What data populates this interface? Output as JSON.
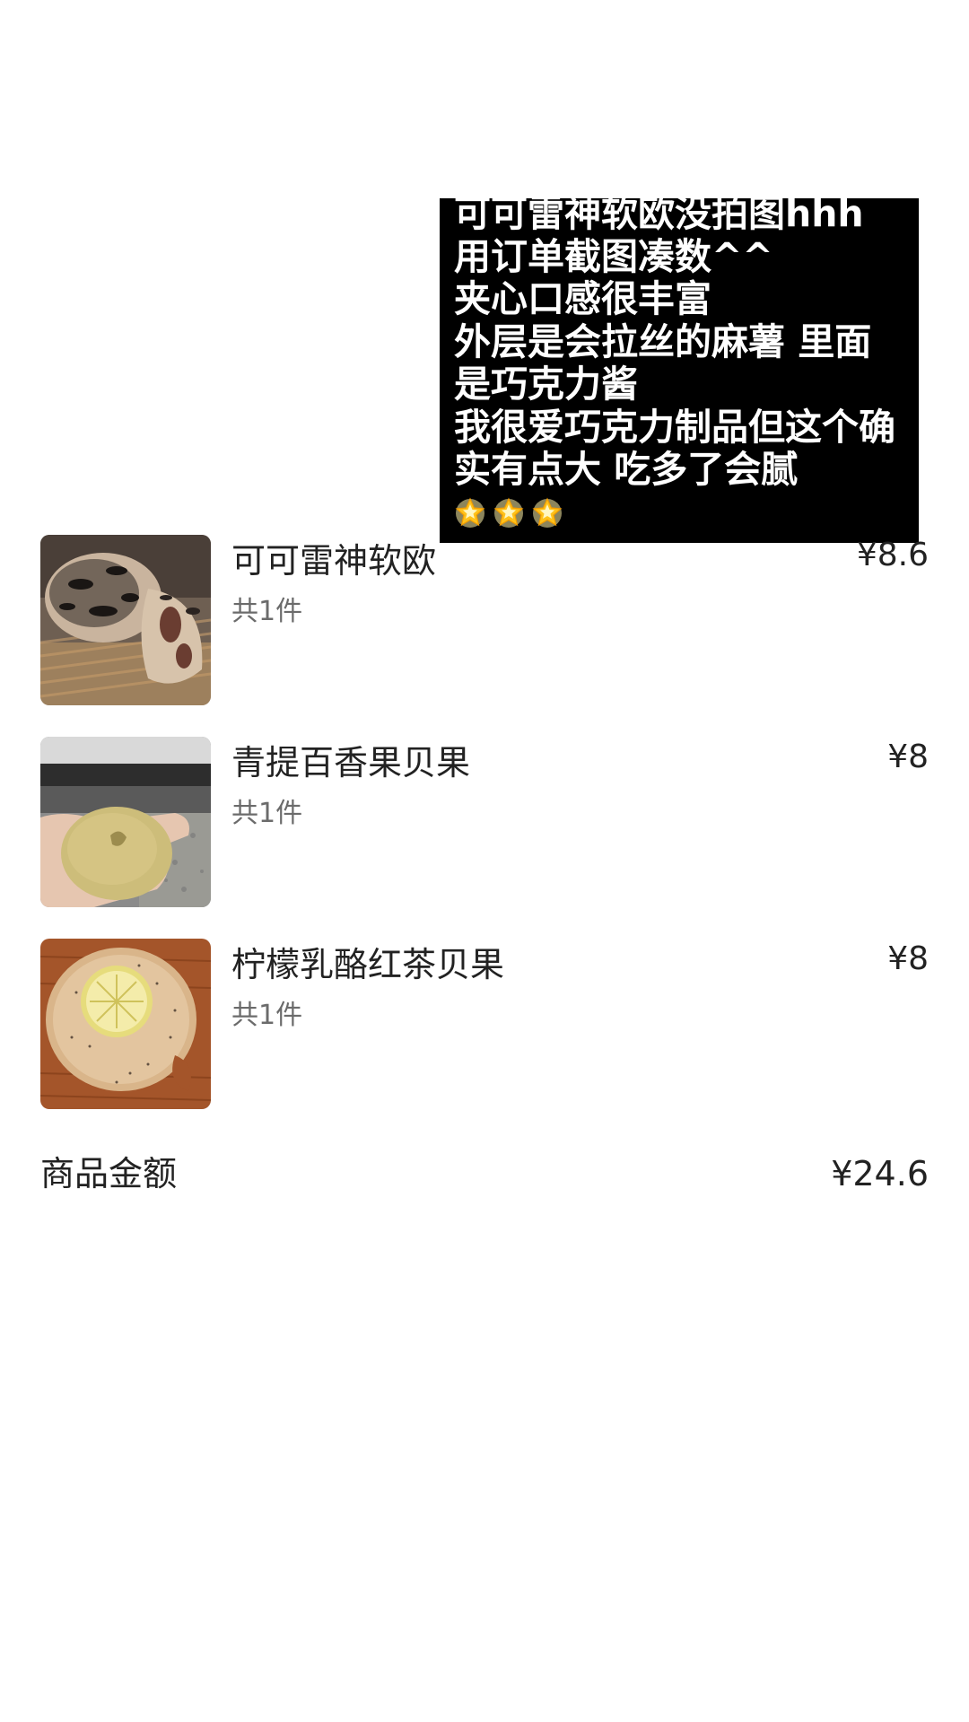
{
  "note": {
    "lines": [
      "可可雷神软欧没拍图hhh",
      "用订单截图凑数^^",
      "夹心口感很丰富",
      "外层是会拉丝的麻薯  里面",
      "是巧克力酱",
      "我很爱巧克力制品但这个确",
      "实有点大  吃多了会腻"
    ],
    "star_count": 3,
    "star_icon": "glowing-star-emoji",
    "background": "#000000",
    "text_color": "#ffffff"
  },
  "items": [
    {
      "name": "可可雷神软欧",
      "qty": "共1件",
      "price": "¥8.6",
      "thumb": "cocoa-soft-bread-photo"
    },
    {
      "name": "青提百香果贝果",
      "qty": "共1件",
      "price": "¥8",
      "thumb": "green-bagel-in-hand-photo"
    },
    {
      "name": "柠檬乳酪红茶贝果",
      "qty": "共1件",
      "price": "¥8",
      "thumb": "lemon-tea-bagel-photo"
    }
  ],
  "total": {
    "label": "商品金额",
    "value": "¥24.6"
  }
}
